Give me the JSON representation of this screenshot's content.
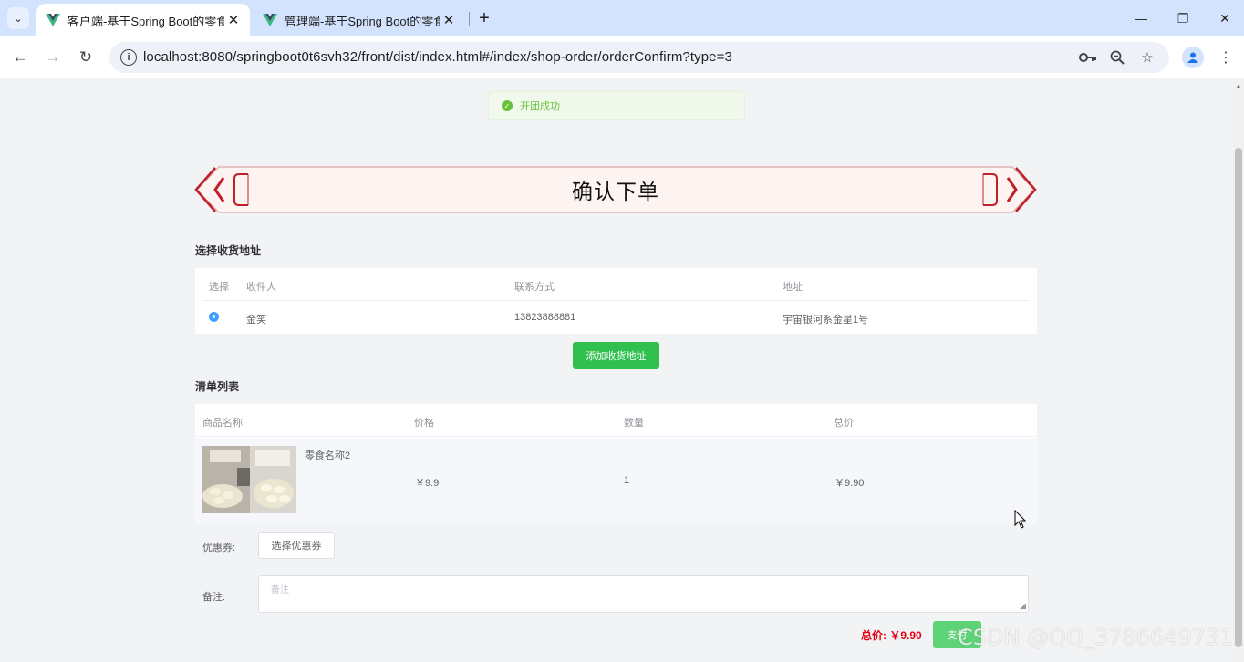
{
  "browser": {
    "tabs": [
      {
        "title": "客户端-基于Spring Boot的零食",
        "active": true
      },
      {
        "title": "管理端-基于Spring Boot的零食",
        "active": false
      }
    ],
    "url": "localhost:8080/springboot0t6svh32/front/dist/index.html#/index/shop-order/orderConfirm?type=3"
  },
  "toast": {
    "message": "开团成功"
  },
  "banner": {
    "title": "确认下单"
  },
  "address_section": {
    "title": "选择收货地址",
    "columns": [
      "选择",
      "收件人",
      "联系方式",
      "地址"
    ],
    "rows": [
      {
        "selected": true,
        "name": "金笑",
        "phone": "13823888881",
        "address": "宇宙银河系金星1号"
      }
    ],
    "add_button": "添加收货地址"
  },
  "item_section": {
    "title": "清单列表",
    "columns": [
      "商品名称",
      "价格",
      "数量",
      "总价"
    ],
    "rows": [
      {
        "name": "零食名称2",
        "price": "￥9.9",
        "quantity": "1",
        "total": "￥9.90"
      }
    ]
  },
  "coupon": {
    "label": "优惠券:",
    "button": "选择优惠券"
  },
  "remark": {
    "label": "备注:",
    "placeholder": "备注"
  },
  "footer": {
    "total": "总价: ￥9.90",
    "pay_button": "支付"
  },
  "watermark": "CSDN @QQ_3786649731",
  "colors": {
    "accent_green": "#2fc050",
    "price_red": "#e60012",
    "radio_blue": "#409eff",
    "banner_red": "#c0202b"
  }
}
